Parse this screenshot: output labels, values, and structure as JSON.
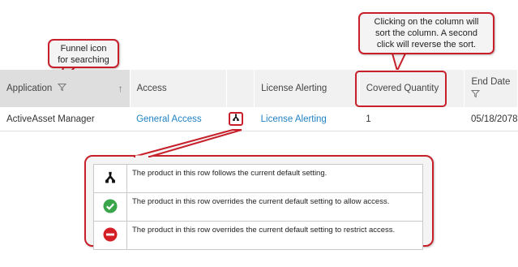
{
  "callouts": {
    "funnel": "Funnel icon\nfor searching",
    "sort": "Clicking on the column will\nsort the column. A second\nclick will reverse the sort."
  },
  "table": {
    "columns": [
      "Application",
      "Access",
      "",
      "License Alerting",
      "Covered Quantity",
      "End Date"
    ],
    "row": {
      "application": "ActiveAsset Manager",
      "access": "General Access",
      "access_setting_icon": "default-setting-icon",
      "license_alerting": "License Alerting",
      "covered_quantity": "1",
      "end_date": "05/18/2078"
    },
    "sort_column": "Application",
    "sort_direction": "ascending"
  },
  "legend": [
    {
      "icon": "default-setting-icon",
      "text": "The product in this row follows the current default setting."
    },
    {
      "icon": "allow-checkmark-icon",
      "text": "The product in this row overrides the current default setting to allow access."
    },
    {
      "icon": "restrict-minus-icon",
      "text": "The product in this row overrides the current default setting to restrict access."
    }
  ],
  "colors": {
    "accent_red": "#c8202b",
    "link_blue": "#1f82c4",
    "allow_green": "#3aa54a",
    "restrict_red": "#d51f26",
    "header_bg": "#f1f1f1",
    "sorted_header_bg": "#dedede"
  }
}
